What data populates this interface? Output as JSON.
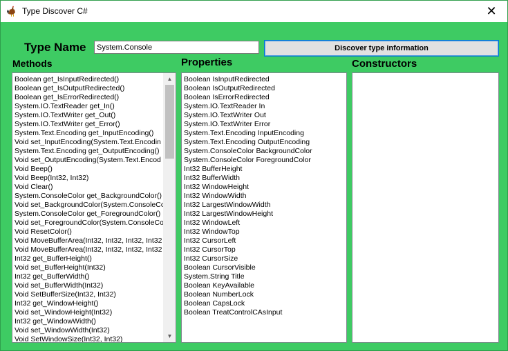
{
  "window": {
    "title": "Type Discover C#",
    "close_glyph": "✕",
    "icon": "rooster-icon",
    "background": "#3ecb63"
  },
  "form": {
    "type_name_label": "Type Name",
    "type_name_value": "System.Console",
    "discover_button": "Discover type information",
    "methods_label": "Methods",
    "properties_label": "Properties",
    "constructors_label": "Constructors"
  },
  "methods": [
    "Boolean get_IsInputRedirected()",
    "Boolean get_IsOutputRedirected()",
    "Boolean get_IsErrorRedirected()",
    "System.IO.TextReader get_In()",
    "System.IO.TextWriter get_Out()",
    "System.IO.TextWriter get_Error()",
    "System.Text.Encoding get_InputEncoding()",
    "Void set_InputEncoding(System.Text.Encodin",
    "System.Text.Encoding get_OutputEncoding()",
    "Void set_OutputEncoding(System.Text.Encod",
    "Void Beep()",
    "Void Beep(Int32, Int32)",
    "Void Clear()",
    "System.ConsoleColor get_BackgroundColor()",
    "Void set_BackgroundColor(System.ConsoleCo",
    "System.ConsoleColor get_ForegroundColor()",
    "Void set_ForegroundColor(System.ConsoleCol",
    "Void ResetColor()",
    "Void MoveBufferArea(Int32, Int32, Int32, Int32",
    "Void MoveBufferArea(Int32, Int32, Int32, Int32",
    "Int32 get_BufferHeight()",
    "Void set_BufferHeight(Int32)",
    "Int32 get_BufferWidth()",
    "Void set_BufferWidth(Int32)",
    "Void SetBufferSize(Int32, Int32)",
    "Int32 get_WindowHeight()",
    "Void set_WindowHeight(Int32)",
    "Int32 get_WindowWidth()",
    "Void set_WindowWidth(Int32)",
    "Void SetWindowSize(Int32, Int32)"
  ],
  "methods_scroll": {
    "up_glyph": "▲",
    "down_glyph": "▼",
    "thumb_fraction": 0.3
  },
  "properties": [
    "Boolean IsInputRedirected",
    "Boolean IsOutputRedirected",
    "Boolean IsErrorRedirected",
    "System.IO.TextReader In",
    "System.IO.TextWriter Out",
    "System.IO.TextWriter Error",
    "System.Text.Encoding InputEncoding",
    "System.Text.Encoding OutputEncoding",
    "System.ConsoleColor BackgroundColor",
    "System.ConsoleColor ForegroundColor",
    "Int32 BufferHeight",
    "Int32 BufferWidth",
    "Int32 WindowHeight",
    "Int32 WindowWidth",
    "Int32 LargestWindowWidth",
    "Int32 LargestWindowHeight",
    "Int32 WindowLeft",
    "Int32 WindowTop",
    "Int32 CursorLeft",
    "Int32 CursorTop",
    "Int32 CursorSize",
    "Boolean CursorVisible",
    "System.String Title",
    "Boolean KeyAvailable",
    "Boolean NumberLock",
    "Boolean CapsLock",
    "Boolean TreatControlCAsInput"
  ],
  "constructors": []
}
